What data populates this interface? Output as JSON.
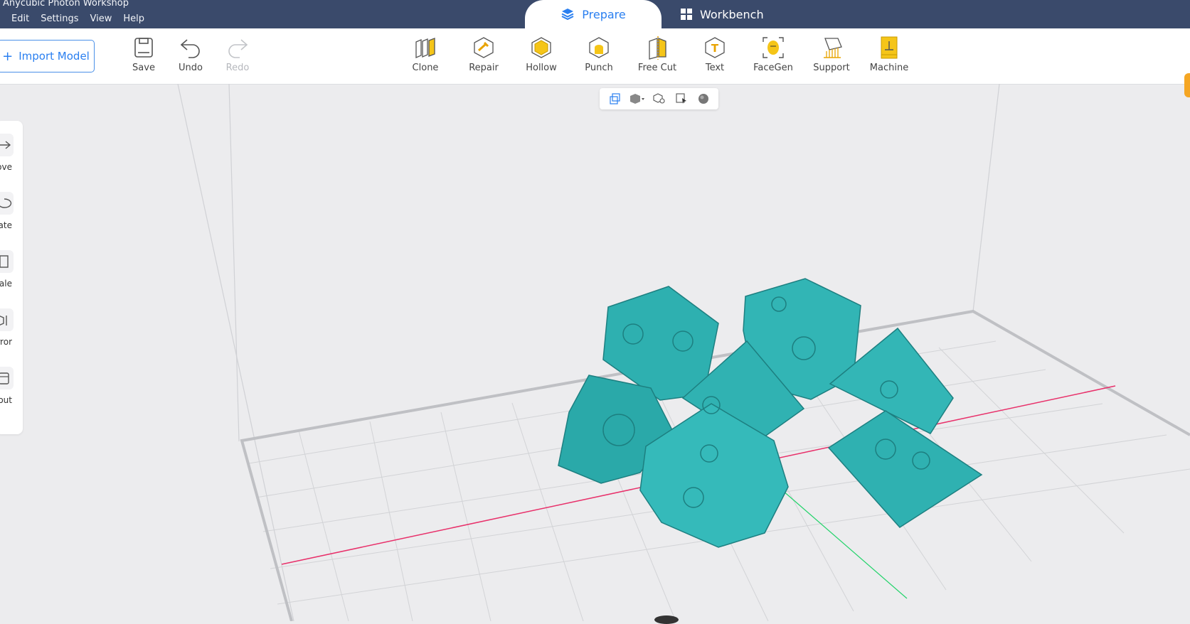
{
  "app": {
    "title": "Anycubic Photon Workshop"
  },
  "menu": [
    "Edit",
    "Settings",
    "View",
    "Help"
  ],
  "tabs": {
    "prepare": "Prepare",
    "workbench": "Workbench"
  },
  "toolbar": {
    "import_label": "Import Model",
    "save": "Save",
    "undo": "Undo",
    "redo": "Redo",
    "tools": [
      "Clone",
      "Repair",
      "Hollow",
      "Punch",
      "Free Cut",
      "Text",
      "FaceGen",
      "Support",
      "Machine"
    ]
  },
  "sidebar": [
    "ove",
    "ate",
    "ale",
    "rror",
    "yout"
  ],
  "colors": {
    "accent": "#2a7ff0",
    "titlebar": "#3a4a6b",
    "model": "#2fb3b3",
    "x_axis": "#e8306a",
    "y_axis": "#22d36a"
  }
}
